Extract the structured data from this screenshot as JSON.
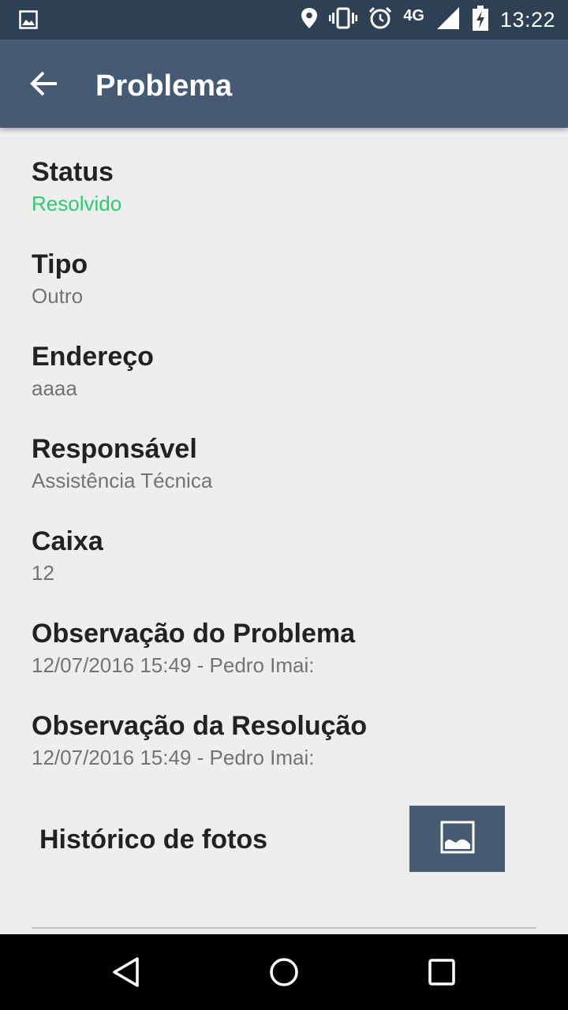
{
  "status_bar": {
    "network": "4G",
    "time": "13:22",
    "icons": [
      "image-notification-icon",
      "location-icon",
      "vibrate-icon",
      "alarm-icon",
      "signal-icon",
      "battery-charging-icon"
    ]
  },
  "app_bar": {
    "title": "Problema",
    "back_icon": "arrow-back-icon"
  },
  "fields": [
    {
      "label": "Status",
      "value": "Resolvido",
      "value_color": "#2ecc71"
    },
    {
      "label": "Tipo",
      "value": "Outro"
    },
    {
      "label": "Endereço",
      "value": "aaaa"
    },
    {
      "label": "Responsável",
      "value": "Assistência Técnica"
    },
    {
      "label": "Caixa",
      "value": "12"
    },
    {
      "label": "Observação do Problema",
      "value": "12/07/2016 15:49 - Pedro Imai:"
    },
    {
      "label": "Observação da Resolução",
      "value": "12/07/2016 15:49 - Pedro Imai:"
    }
  ],
  "photos": {
    "label": "Histórico de fotos",
    "button_icon": "image-icon"
  },
  "nav_bar": {
    "icons": [
      "back-triangle-icon",
      "home-circle-icon",
      "recents-square-icon"
    ]
  },
  "colors": {
    "app_bar": "#465a73",
    "status_bar": "#2e4054",
    "status_resolved": "#2ecc71"
  }
}
